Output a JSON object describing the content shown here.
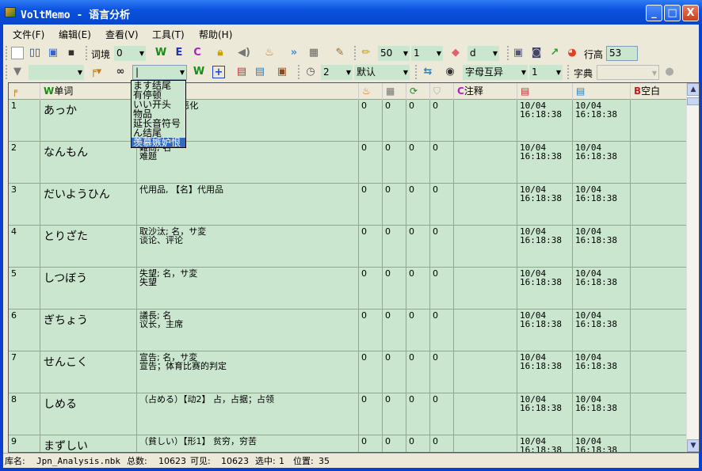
{
  "window": {
    "title": "VoltMemo - 语言分析"
  },
  "menu": [
    "文件(F)",
    "编辑(E)",
    "查看(V)",
    "工具(T)",
    "帮助(H)"
  ],
  "toolbar1": {
    "context_label": "词境",
    "context_value": "0",
    "w": "W",
    "e": "E",
    "c": "C",
    "size_value": "50",
    "count_value": "1",
    "eraser_value": "d",
    "row_height_label": "行高",
    "row_height_value": "53"
  },
  "toolbar2": {
    "filter_value": "",
    "search_value": "|",
    "w": "W",
    "time_value": "2",
    "mode_value": "默认",
    "letter_mode": "字母互异",
    "letter_value": "1",
    "dict_label": "字典",
    "dict_value": ""
  },
  "dropdown": {
    "items": [
      "ます结尾",
      "有停顿",
      "いい开头",
      "物品",
      "延长音符号",
      "ん结尾",
      "羡慕嫉妒恨"
    ],
    "selected": 6
  },
  "columns": {
    "word": "单词",
    "note": "注释",
    "blank": "空白"
  },
  "rows": [
    {
      "n": "1",
      "word": "あっか",
      "meaning": "悪化; [名] 恶化",
      "v": [
        "0",
        "0",
        "0",
        "0"
      ],
      "note": "",
      "created": "10/04\n16:18:38",
      "modified": "10/04\n16:18:38",
      "blank": ""
    },
    {
      "n": "2",
      "word": "なんもん",
      "meaning": "難問; 名\n难题",
      "v": [
        "0",
        "0",
        "0",
        "0"
      ],
      "note": "",
      "created": "10/04\n16:18:38",
      "modified": "10/04\n16:18:38",
      "blank": ""
    },
    {
      "n": "3",
      "word": "だいようひん",
      "meaning": "代用品, 【名】代用品",
      "v": [
        "0",
        "0",
        "0",
        "0"
      ],
      "note": "",
      "created": "10/04\n16:18:38",
      "modified": "10/04\n16:18:38",
      "blank": ""
    },
    {
      "n": "4",
      "word": "とりざた",
      "meaning": "取沙汰; 名，サ変\n谈论、评论",
      "v": [
        "0",
        "0",
        "0",
        "0"
      ],
      "note": "",
      "created": "10/04\n16:18:38",
      "modified": "10/04\n16:18:38",
      "blank": ""
    },
    {
      "n": "5",
      "word": "しつぼう",
      "meaning": "失望; 名，サ変\n失望",
      "v": [
        "0",
        "0",
        "0",
        "0"
      ],
      "note": "",
      "created": "10/04\n16:18:38",
      "modified": "10/04\n16:18:38",
      "blank": ""
    },
    {
      "n": "6",
      "word": "ぎちょう",
      "meaning": "議長; 名\n议长，主席",
      "v": [
        "0",
        "0",
        "0",
        "0"
      ],
      "note": "",
      "created": "10/04\n16:18:38",
      "modified": "10/04\n16:18:38",
      "blank": ""
    },
    {
      "n": "7",
      "word": "せんこく",
      "meaning": "宣告; 名，サ変\n宣告；体育比赛的判定",
      "v": [
        "0",
        "0",
        "0",
        "0"
      ],
      "note": "",
      "created": "10/04\n16:18:38",
      "modified": "10/04\n16:18:38",
      "blank": ""
    },
    {
      "n": "8",
      "word": "しめる",
      "meaning": "（占める）【动2】 占，占据；占领",
      "v": [
        "0",
        "0",
        "0",
        "0"
      ],
      "note": "",
      "created": "10/04\n16:18:38",
      "modified": "10/04\n16:18:38",
      "blank": ""
    },
    {
      "n": "9",
      "word": "まずしい",
      "meaning": "（貧しい）【形1】 贫穷，穷苦",
      "v": [
        "0",
        "0",
        "0",
        "0"
      ],
      "note": "",
      "created": "10/04\n16:18:38",
      "modified": "10/04\n16:18:38",
      "blank": ""
    }
  ],
  "status": {
    "db_label": "库名:",
    "db_value": "Jpn_Analysis.nbk",
    "total_label": "总数:",
    "total_value": "10623",
    "visible_label": "可见:",
    "visible_value": "10623",
    "selected_label": "选中:",
    "selected_value": "1",
    "position_label": "位置:",
    "position_value": "35"
  }
}
